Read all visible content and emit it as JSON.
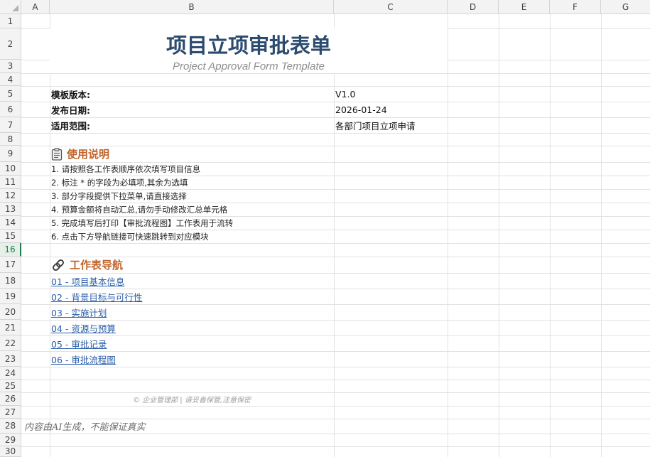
{
  "columns": [
    "A",
    "B",
    "C",
    "D",
    "E",
    "F",
    "G"
  ],
  "rows": [
    "1",
    "2",
    "3",
    "4",
    "5",
    "6",
    "7",
    "8",
    "9",
    "10",
    "11",
    "12",
    "13",
    "14",
    "15",
    "16",
    "17",
    "18",
    "19",
    "20",
    "21",
    "22",
    "23",
    "24",
    "25",
    "26",
    "27",
    "28",
    "29",
    "30"
  ],
  "active_row": "16",
  "form": {
    "title": "项目立项审批表单",
    "subtitle": "Project Approval Form Template",
    "fields": [
      {
        "label": "模板版本:",
        "value": "V1.0"
      },
      {
        "label": "发布日期:",
        "value": "2026-01-24"
      },
      {
        "label": "适用范围:",
        "value": "各部门项目立项申请"
      }
    ]
  },
  "instructions": {
    "heading": "使用说明",
    "icon": "clipboard-icon",
    "items": [
      "1. 请按照各工作表顺序依次填写项目信息",
      "2. 标注 * 的字段为必填项,其余为选填",
      "3. 部分字段提供下拉菜单,请直接选择",
      "4. 预算金额将自动汇总,请勿手动修改汇总单元格",
      "5. 完成填写后打印【审批流程图】工作表用于流转",
      "6. 点击下方导航链接可快速跳转到对应模块"
    ]
  },
  "navigation": {
    "heading": "工作表导航",
    "icon": "link-icon",
    "links": [
      "01 - 项目基本信息",
      "02 - 背景目标与可行性",
      "03 - 实施计划",
      "04 - 资源与预算",
      "05 - 审批记录",
      "06 - 审批流程图"
    ]
  },
  "footer": "© 企业管理部 | 请妥善保管,注意保密",
  "disclaimer": "内容由AI生成，不能保证真实",
  "colors": {
    "title": "#2b4b6f",
    "section": "#c0642b",
    "link": "#2a5ea8",
    "active_row": "#1a7f4b"
  }
}
